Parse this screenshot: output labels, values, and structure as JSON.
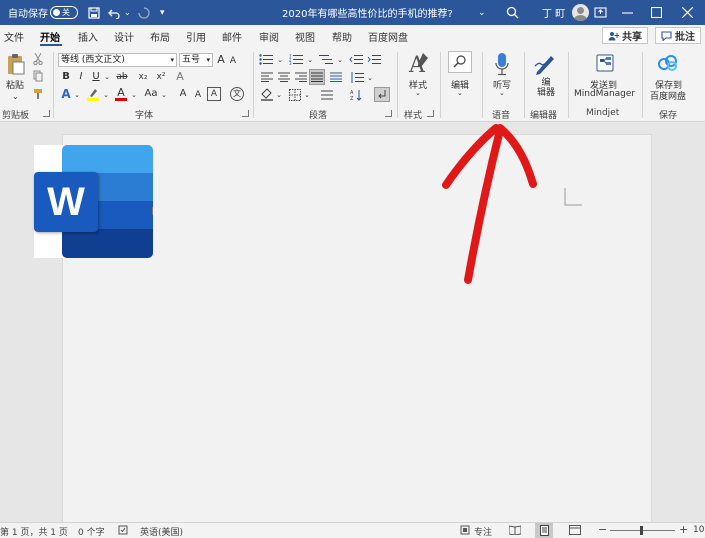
{
  "titlebar": {
    "autosave_label": "自动保存",
    "autosave_state": "关",
    "document_title": "2020年有哪些高性价比的手机的推荐?",
    "title_dropdown": "⌄",
    "user_name": "丁 町",
    "colors": {
      "accent": "#2b579a"
    }
  },
  "tabs": [
    "文件",
    "开始",
    "插入",
    "设计",
    "布局",
    "引用",
    "邮件",
    "审阅",
    "视图",
    "帮助",
    "百度网盘"
  ],
  "share_label": "共享",
  "comments_label": "批注",
  "ribbon": {
    "clipboard": {
      "paste_label": "粘贴",
      "group_label": "剪贴板"
    },
    "font": {
      "font_name": "等线 (西文正文)",
      "font_size": "五号",
      "group_label": "字体",
      "grow_label": "A",
      "shrink_label": "A",
      "case_label": "Aa",
      "bold_label": "B",
      "italic_label": "I",
      "underline_label": "U",
      "strike_label": "ab",
      "subscript_label": "x₂",
      "superscript_label": "x²",
      "text_effect_label": "A",
      "highlight_label": "ab",
      "font_color_label": "A",
      "clear_format_label": "A",
      "char_border_label": "A",
      "phonetic_label": "文"
    },
    "paragraph": {
      "group_label": "段落"
    },
    "styles": {
      "label": "样式",
      "group_label": "样式"
    },
    "editing": {
      "label": "编辑"
    },
    "voice": {
      "dictate_label": "听写",
      "group_label": "语音"
    },
    "editor": {
      "label": "编\n辑器",
      "group_label": "编辑器"
    },
    "mindjet": {
      "label_1": "发送到",
      "label_2": "MindManager",
      "group_label": "Mindjet"
    },
    "save": {
      "label_1": "保存到",
      "label_2": "百度网盘",
      "group_label": "保存"
    }
  },
  "document": {
    "logo_letter": "W"
  },
  "statusbar": {
    "page_info": "第 1 页，共 1 页",
    "word_count": "0 个字",
    "language": "英语(美国)",
    "focus_label": "专注",
    "zoom_minus": "−",
    "zoom_plus": "+",
    "zoom_value": "10"
  }
}
